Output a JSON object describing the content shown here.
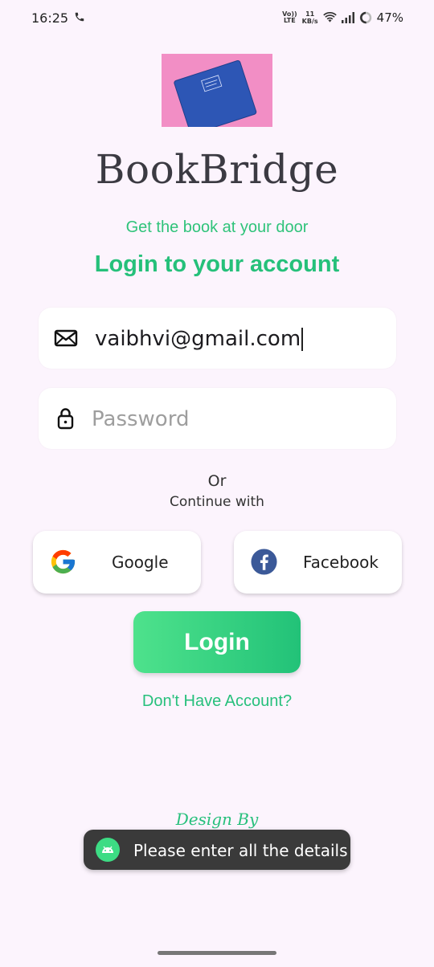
{
  "status_bar": {
    "time": "16:25",
    "volte_top": "Vo))",
    "volte_bottom": "LTE",
    "net_speed_value": "11",
    "net_speed_unit": "KB/s",
    "battery": "47%",
    "icons": [
      "phone-call-icon",
      "wifi-icon",
      "signal-icon",
      "battery-ring-icon"
    ]
  },
  "header": {
    "title": "BookBridge",
    "tagline": "Get the book at your door",
    "heading": "Login to your account"
  },
  "form": {
    "email_value": "vaibhvi@gmail.com",
    "password_placeholder": "Password"
  },
  "divider": {
    "or": "Or",
    "continue": "Continue with"
  },
  "social": {
    "google_label": "Google",
    "facebook_label": "Facebook"
  },
  "actions": {
    "login_label": "Login",
    "signup_link": "Don't Have Account?"
  },
  "footer": {
    "design_by": "Design By"
  },
  "toast": {
    "message": "Please enter all the details"
  },
  "colors": {
    "accent": "#25c07a",
    "background": "#fcf4fd",
    "title": "#3b3a42",
    "image_bg": "#f28ec5",
    "book": "#2d56b5"
  }
}
